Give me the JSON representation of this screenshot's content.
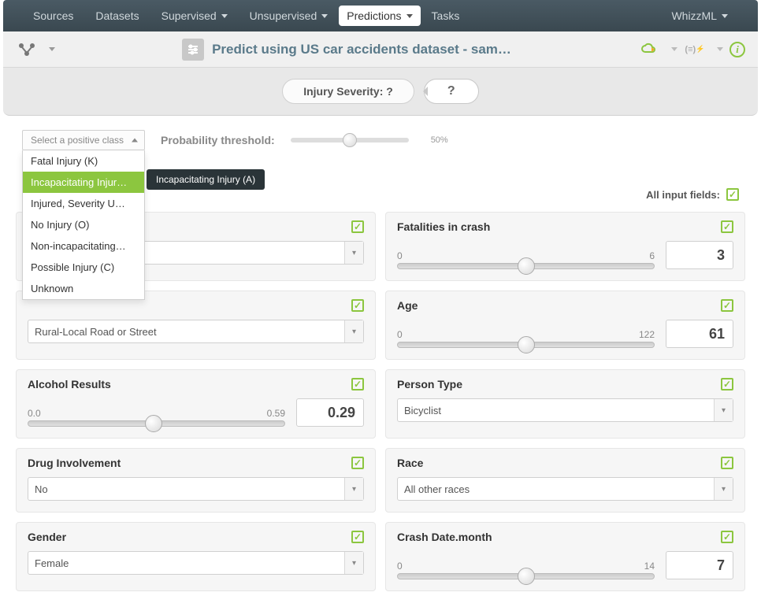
{
  "nav": {
    "items": [
      "Sources",
      "Datasets",
      "Supervised",
      "Unsupervised",
      "Predictions",
      "Tasks"
    ],
    "right": "WhizzML"
  },
  "titlebar": {
    "title": "Predict using US car accidents dataset - sam…"
  },
  "prediction": {
    "label": "Injury Severity: ?",
    "result": "?"
  },
  "positive_class": {
    "placeholder": "Select a positive class",
    "options": [
      "Fatal Injury (K)",
      "Incapacitating Injur…",
      "Injured, Severity U…",
      "No Injury (O)",
      "Non-incapacitating…",
      "Possible Injury (C)",
      "Unknown"
    ],
    "highlighted_index": 1,
    "tooltip": "Incapacitating Injury (A)"
  },
  "threshold": {
    "label": "Probability threshold:",
    "value_pct": "50%",
    "value": 50
  },
  "all_fields_label": "All input fields:",
  "fields": {
    "left": [
      {
        "title": "",
        "type": "select",
        "value": "",
        "placeholder_row": true
      },
      {
        "title": "",
        "type": "select",
        "value": "Rural-Local Road or Street",
        "truncated_head": true
      },
      {
        "title": "Alcohol Results",
        "type": "slider",
        "min": "0.0",
        "max": "0.59",
        "value": "0.29",
        "pos": 49
      },
      {
        "title": "Drug Involvement",
        "type": "select",
        "value": "No"
      },
      {
        "title": "Gender",
        "type": "select",
        "value": "Female"
      }
    ],
    "right": [
      {
        "title": "Fatalities in crash",
        "type": "slider",
        "min": "0",
        "max": "6",
        "value": "3",
        "pos": 50
      },
      {
        "title": "Age",
        "type": "slider",
        "min": "0",
        "max": "122",
        "value": "61",
        "pos": 50
      },
      {
        "title": "Person Type",
        "type": "select",
        "value": "Bicyclist"
      },
      {
        "title": "Race",
        "type": "select",
        "value": "All other races"
      },
      {
        "title": "Crash Date.month",
        "type": "slider",
        "min": "0",
        "max": "14",
        "value": "7",
        "pos": 50
      }
    ]
  }
}
